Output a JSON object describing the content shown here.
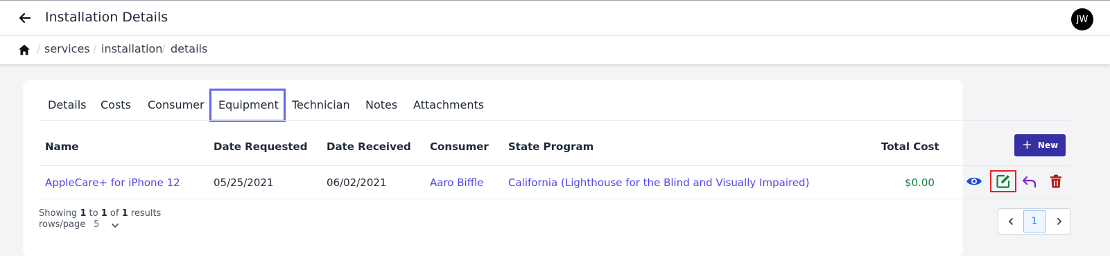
{
  "header": {
    "title": "Installation Details",
    "back_icon": "arrow-left-icon",
    "avatar_initials": "JW"
  },
  "breadcrumb": {
    "home_icon": "home-icon",
    "items": [
      "services",
      "installation",
      "details"
    ],
    "separator": "/"
  },
  "tabs": [
    {
      "label": "Details"
    },
    {
      "label": "Costs"
    },
    {
      "label": "Consumer"
    },
    {
      "label": "Equipment",
      "active": true
    },
    {
      "label": "Technician"
    },
    {
      "label": "Notes"
    },
    {
      "label": "Attachments"
    }
  ],
  "table": {
    "columns": [
      "Name",
      "Date Requested",
      "Date Received",
      "Consumer",
      "State Program",
      "Total Cost"
    ],
    "new_button": "New",
    "rows": [
      {
        "name": "AppleCare+ for iPhone 12",
        "date_requested": "05/25/2021",
        "date_received": "06/02/2021",
        "consumer": "Aaro Biffle",
        "state_program": "California (Lighthouse for the Blind and Visually Impaired)",
        "total_cost": "$0.00",
        "actions": [
          "eye-icon",
          "edit-icon",
          "undo-icon",
          "trash-icon"
        ]
      }
    ]
  },
  "footer": {
    "showing_prefix": "Showing",
    "from": "1",
    "to_word": "to",
    "to": "1",
    "of_word": "of",
    "total": "1",
    "results_word": "results",
    "rows_label": "rows/page",
    "rows_value": "5"
  },
  "pagination": {
    "current_page": "1"
  },
  "colors": {
    "accent": "#3730a3",
    "link": "#4f46e5",
    "cost": "#15803d",
    "active_tab_outline": "#6366f1",
    "edit_highlight": "#dc2626"
  }
}
